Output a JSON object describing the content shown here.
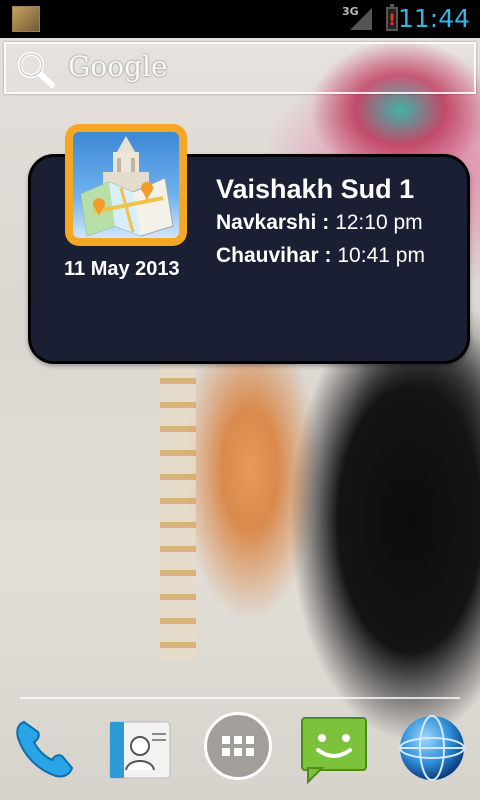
{
  "statusbar": {
    "network_type": "3G",
    "time": "11:44",
    "battery_alert": "!",
    "notification_icon": "app-notification-icon",
    "signal_icon": "signal-icon",
    "battery_icon": "battery-icon"
  },
  "search": {
    "label": "Google",
    "icon": "search-icon"
  },
  "widget": {
    "date": "11 May 2013",
    "tithi": "Vaishakh Sud 1",
    "navkarshi_label": "Navkarshi :",
    "navkarshi_time": "12:10 pm",
    "chauvihar_label": "Chauvihar :",
    "chauvihar_time": "10:41 pm",
    "icon": "temple-map-icon",
    "background_color": "#1b1f33",
    "icon_frame_color": "#f5a623"
  },
  "dock": {
    "items": [
      "phone-icon",
      "contacts-icon",
      "app-drawer-icon",
      "messaging-icon",
      "browser-icon"
    ]
  },
  "colors": {
    "clock": "#33b5e5",
    "battery_alert": "#ff2a1a"
  }
}
